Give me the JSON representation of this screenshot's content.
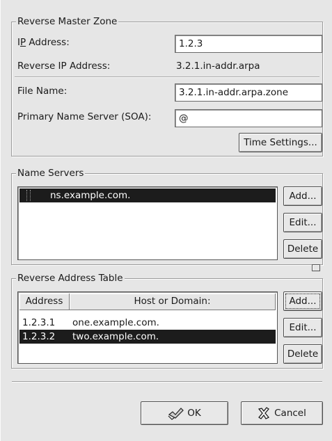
{
  "reverse_master_zone": {
    "title": "Reverse Master Zone",
    "ip_address_label": "IP Address:",
    "ip_address_mnemonic": "P",
    "ip_address_value": "1.2.3",
    "reverse_ip_label": "Reverse IP Address:",
    "reverse_ip_value": "3.2.1.in-addr.arpa",
    "file_name_label": "File Name:",
    "file_name_value": "3.2.1.in-addr.arpa.zone",
    "primary_ns_label": "Primary Name Server (SOA):",
    "primary_ns_value": "@",
    "time_settings_button": "Time Settings..."
  },
  "name_servers": {
    "title": "Name Servers",
    "items": [
      "ns.example.com."
    ],
    "selected_index": 0,
    "add_button": "Add...",
    "edit_button": "Edit...",
    "delete_button": "Delete"
  },
  "reverse_address_table": {
    "title": "Reverse Address Table",
    "columns": [
      "Address",
      "Host or Domain:"
    ],
    "rows": [
      {
        "address": "1.2.3.1",
        "host": "one.example.com."
      },
      {
        "address": "1.2.3.2",
        "host": "two.example.com."
      }
    ],
    "selected_index": 1,
    "add_button": "Add...",
    "edit_button": "Edit...",
    "delete_button": "Delete"
  },
  "dialog_buttons": {
    "ok": "OK",
    "cancel": "Cancel"
  },
  "colors": {
    "window_bg": "#e6e6e6",
    "selection_bg": "#1c1c1c",
    "selection_fg": "#ffffff"
  },
  "icons": {
    "ok_icon": "check-hand-icon",
    "cancel_icon": "x-cross-icon",
    "pane_handle": "grip-handle-icon"
  }
}
